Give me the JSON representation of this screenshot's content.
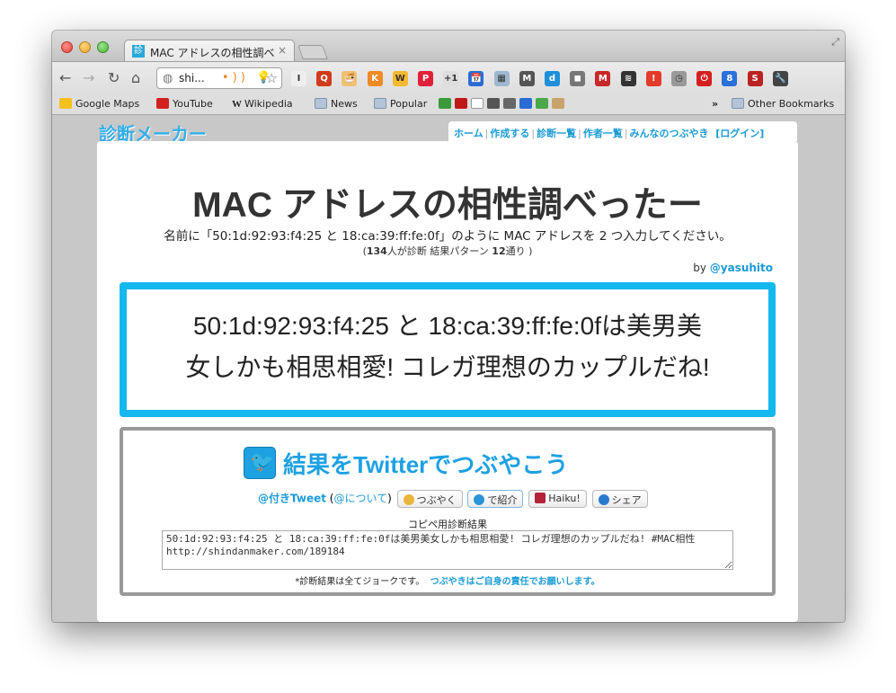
{
  "browser": {
    "tab_title": "MAC アドレスの相性調べった",
    "tab_close": "×",
    "omnibox_text": "shi...",
    "omnibox_icons": "•)) 💡",
    "bookmarks": [
      {
        "label": "Google Maps",
        "color": "#4a8f3c"
      },
      {
        "label": "YouTube",
        "color": "#d12020"
      },
      {
        "label": "Wikipedia",
        "color": "#ffffff"
      },
      {
        "label": "News",
        "color": "folder"
      },
      {
        "label": "Popular",
        "color": "folder"
      }
    ],
    "bookmarks_overflow": "»",
    "other_bookmarks": "Other Bookmarks",
    "extension_icons": [
      "I",
      "Q",
      "🍜",
      "K",
      "W",
      "P",
      "+1",
      "📅",
      "▦",
      "M",
      "d",
      "◼",
      "M",
      "≋",
      "!",
      "◷",
      "⏻",
      "8",
      "S",
      "🔧"
    ]
  },
  "site": {
    "logo": "診断メーカー",
    "nav": [
      "ホーム",
      "作成する",
      "診断一覧",
      "作者一覧",
      "みんなのつぶやき"
    ],
    "login": "[ログイン]"
  },
  "diagnosis": {
    "title": "MAC アドレスの相性調べったー",
    "description": "名前に「50:1d:92:93:f4:25 と 18:ca:39:ff:fe:0f」のように MAC アドレスを 2 つ入力してください。",
    "stats_prefix": "(",
    "stats_count": "134",
    "stats_mid": "人が診断 結果パターン ",
    "stats_patterns": "12",
    "stats_suffix": "通り )",
    "by_prefix": "by ",
    "author": "@yasuhito",
    "result_line1": "50:1d:92:93:f4:25 と 18:ca:39:ff:fe:0fは美男美",
    "result_line2": "女しかも相思相愛! コレガ理想のカップルだね!"
  },
  "share": {
    "title": "結果をTwitterでつぶやこう",
    "tweet_link": "@付きTweet",
    "about_open": " (",
    "about_link": "@について",
    "about_close": ")",
    "tsubuyaku": "つぶやく",
    "shokai": "で紹介",
    "haiku": "Haiku!",
    "share_label": "シェア",
    "copy_label": "コピペ用診断結果",
    "copy_text": "50:1d:92:93:f4:25 と 18:ca:39:ff:fe:0fは美男美女しかも相思相愛! コレガ理想のカップルだね! #MAC相性\nhttp://shindanmaker.com/189184",
    "note_prefix": "*診断結果は全てジョークです。",
    "note_highlight": "つぶやきはご自身の責任でお願いします。"
  }
}
